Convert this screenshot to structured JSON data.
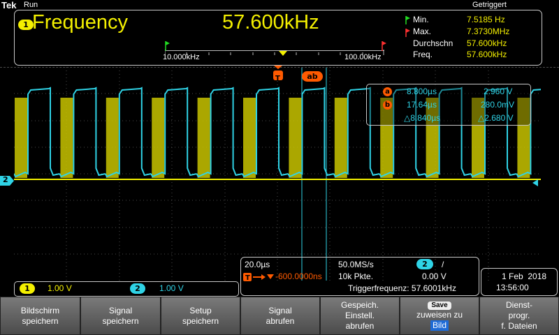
{
  "brand": "Tek",
  "run_state": "Run",
  "trigger_state": "Getriggert",
  "measurement": {
    "channel": "1",
    "name": "Frequency",
    "value": "57.600kHz",
    "stats": [
      {
        "label": "Min.",
        "value": "7.5185 Hz"
      },
      {
        "label": "Max.",
        "value": "7.3730MHz"
      },
      {
        "label": "Durchschn",
        "value": "57.600kHz"
      },
      {
        "label": "Freq.",
        "value": "57.600kHz"
      }
    ],
    "histogram": {
      "low": "10.000kHz",
      "high": "100.00kHz"
    }
  },
  "cursors": {
    "a": {
      "marker": "a",
      "time": "8.800µs",
      "volt": "2.960 V"
    },
    "b": {
      "marker": "b",
      "time": "17.64µs",
      "volt": "280.0mV"
    },
    "delta": {
      "time": "△8.840µs",
      "volt": "△2.680 V"
    }
  },
  "trigger_marker": "T",
  "cursor_marker_ab": "ab",
  "channel_markers": {
    "ch2": "2"
  },
  "channels": [
    {
      "id": "1",
      "scale": "1.00 V",
      "color": "#f4f000"
    },
    {
      "id": "2",
      "scale": "1.00 V",
      "color": "#2fd3e6"
    }
  ],
  "horizontal": {
    "timebase": "20.0µs",
    "position": "-600.0000ns",
    "sample_rate": "50.0MS/s",
    "points": "10k Pkte.",
    "trig_channel": "2",
    "trig_slope": "/",
    "trig_level": "0.00 V",
    "trig_freq": "Triggerfrequenz: 57.6001kHz"
  },
  "datetime": {
    "date": "1 Feb  2018",
    "time": "13:56:00"
  },
  "softkeys": [
    {
      "line1": "Bildschirm",
      "line2": "speichern",
      "line3": ""
    },
    {
      "line1": "Signal",
      "line2": "speichern",
      "line3": ""
    },
    {
      "line1": "Setup",
      "line2": "speichern",
      "line3": ""
    },
    {
      "line1": "Signal",
      "line2": "abrufen",
      "line3": ""
    },
    {
      "line1": "Gespeich.",
      "line2": "Einstell.",
      "line3": "abrufen"
    },
    {
      "line1": "zuweisen zu",
      "line2": "Bild",
      "line3": "",
      "pill": "Save"
    },
    {
      "line1": "Dienst-",
      "line2": "progr.",
      "line3": "f. Dateien"
    }
  ],
  "colors": {
    "ch1": "#f4f000",
    "ch2": "#2fd3e6",
    "marker": "#ff5a00",
    "grid": "#4a4a4a"
  }
}
